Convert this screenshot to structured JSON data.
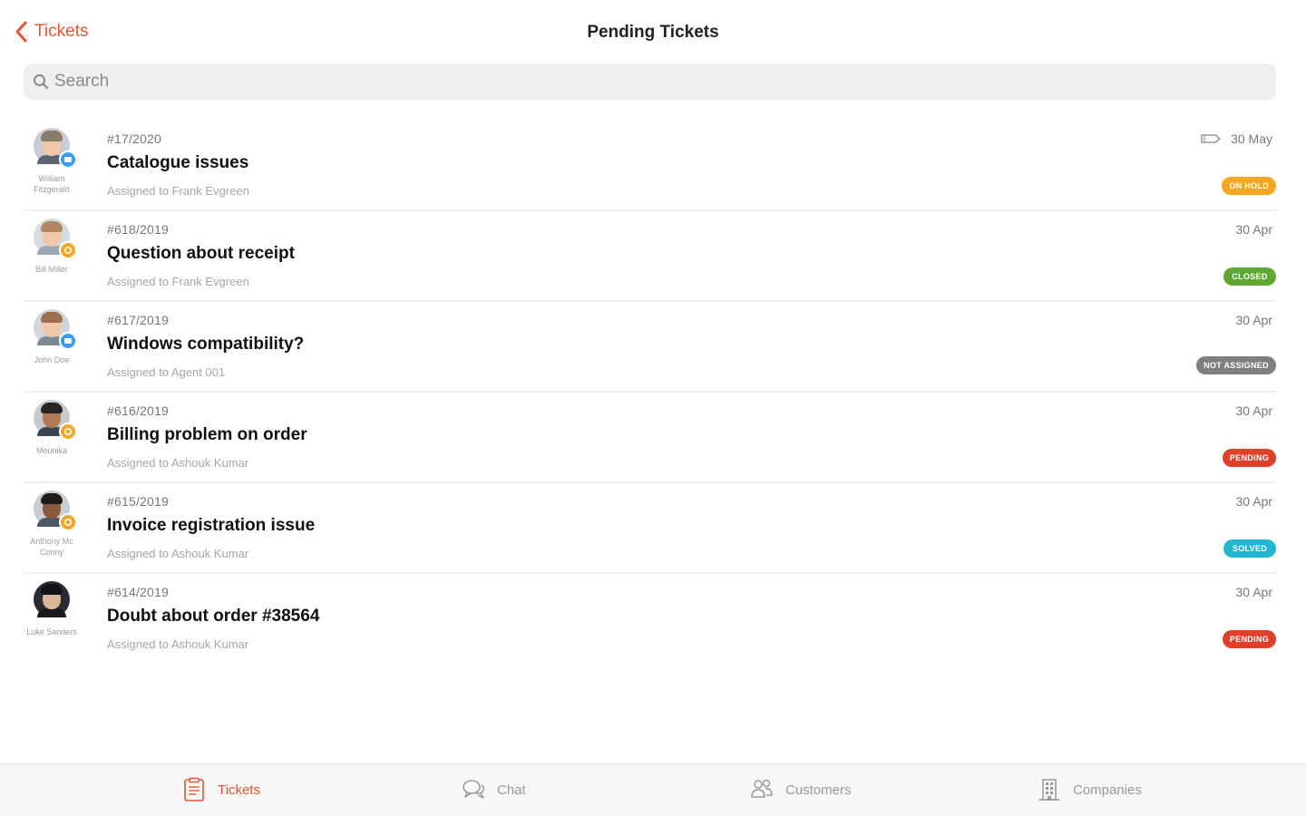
{
  "header": {
    "back_label": "Tickets",
    "title": "Pending Tickets"
  },
  "search": {
    "placeholder": "Search"
  },
  "colors": {
    "accent": "#e8542f",
    "onhold": "#f5a623",
    "closed": "#5fa832",
    "not_assigned": "#7f7f7f",
    "pending": "#e0402a",
    "solved": "#22b6d0",
    "chat_channel": "#3a9bf5",
    "email_channel": "#f5a623"
  },
  "tickets": [
    {
      "id": "#17/2020",
      "subject": "Catalogue issues",
      "assigned": "Assigned to Frank Evgreen",
      "date": "30 May",
      "status": "ON HOLD",
      "customer": "William Fitzgerald",
      "channel": "chat",
      "has_tag_icon": true
    },
    {
      "id": "#618/2019",
      "subject": "Question about receipt",
      "assigned": "Assigned to Frank Evgreen",
      "date": "30 Apr",
      "status": "CLOSED",
      "customer": "Bill Miller",
      "channel": "email",
      "has_tag_icon": false
    },
    {
      "id": "#617/2019",
      "subject": "Windows compatibility?",
      "assigned": "Assigned to Agent 001",
      "date": "30 Apr",
      "status": "NOT ASSIGNED",
      "customer": "John Doe",
      "channel": "chat",
      "has_tag_icon": false
    },
    {
      "id": "#616/2019",
      "subject": "Billing problem on order",
      "assigned": "Assigned to Ashouk Kumar",
      "date": "30 Apr",
      "status": "PENDING",
      "customer": "Mounika",
      "channel": "email",
      "has_tag_icon": false
    },
    {
      "id": "#615/2019",
      "subject": "Invoice registration issue",
      "assigned": "Assigned to Ashouk Kumar",
      "date": "30 Apr",
      "status": "SOLVED",
      "customer": "Anthony Mc Conny",
      "channel": "email",
      "has_tag_icon": false
    },
    {
      "id": "#614/2019",
      "subject": "Doubt about order #38564",
      "assigned": "Assigned to Ashouk Kumar",
      "date": "30 Apr",
      "status": "PENDING",
      "customer": "Luke Sanders",
      "channel": "none",
      "has_tag_icon": false
    }
  ],
  "tabbar": {
    "tickets": {
      "label": "Tickets",
      "icon": "tickets-icon"
    },
    "chat": {
      "label": "Chat",
      "icon": "chat-icon"
    },
    "customers": {
      "label": "Customers",
      "icon": "customers-icon"
    },
    "companies": {
      "label": "Companies",
      "icon": "companies-icon"
    }
  }
}
